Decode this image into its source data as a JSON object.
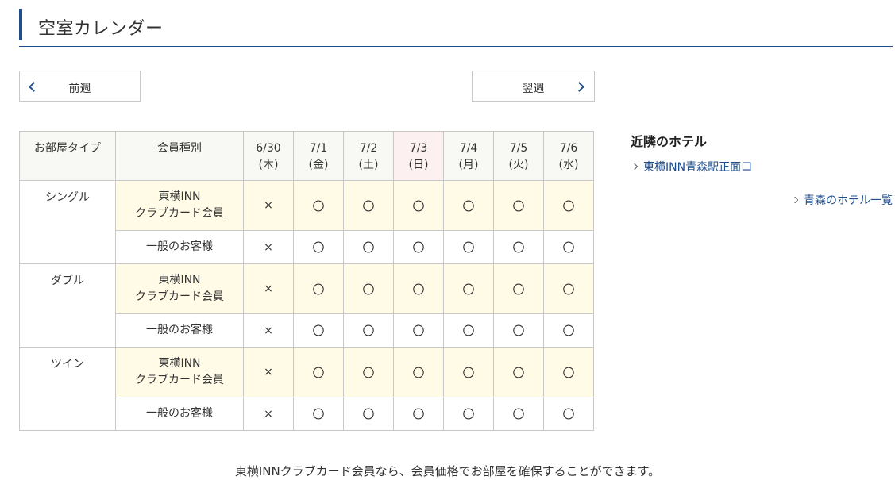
{
  "heading": {
    "title": "空室カレンダー",
    "accent_color": "#1f4e8c"
  },
  "nav": {
    "prev_label": "前週",
    "next_label": "翌週"
  },
  "table": {
    "header_room_type": "お部屋タイプ",
    "header_member_type": "会員種別",
    "days": [
      {
        "date": "6/30",
        "dow": "(木)"
      },
      {
        "date": "7/1",
        "dow": "(金)"
      },
      {
        "date": "7/2",
        "dow": "(土)"
      },
      {
        "date": "7/3",
        "dow": "(日)"
      },
      {
        "date": "7/4",
        "dow": "(月)"
      },
      {
        "date": "7/5",
        "dow": "(火)"
      },
      {
        "date": "7/6",
        "dow": "(水)"
      }
    ],
    "member_line1": "東横INN",
    "member_line2": "クラブカード会員",
    "general_label": "一般のお客様",
    "rooms": [
      {
        "name": "シングル",
        "member": [
          "×",
          "〇",
          "〇",
          "〇",
          "〇",
          "〇",
          "〇"
        ],
        "general": [
          "×",
          "〇",
          "〇",
          "〇",
          "〇",
          "〇",
          "〇"
        ]
      },
      {
        "name": "ダブル",
        "member": [
          "×",
          "〇",
          "〇",
          "〇",
          "〇",
          "〇",
          "〇"
        ],
        "general": [
          "×",
          "〇",
          "〇",
          "〇",
          "〇",
          "〇",
          "〇"
        ]
      },
      {
        "name": "ツイン",
        "member": [
          "×",
          "〇",
          "〇",
          "〇",
          "〇",
          "〇",
          "〇"
        ],
        "general": [
          "×",
          "〇",
          "〇",
          "〇",
          "〇",
          "〇",
          "〇"
        ]
      }
    ],
    "colors": {
      "member_row_bg": "#fffbe6",
      "sunday_header_bg": "#fdf0f0",
      "header_bg": "#f8f8f4"
    }
  },
  "sidebar": {
    "title": "近隣のホテル",
    "nearby_link": "東横INN青森駅正面口",
    "list_link": "青森のホテル一覧"
  },
  "footer": {
    "note": "東横INNクラブカード会員なら、会員価格でお部屋を確保することができます。"
  }
}
